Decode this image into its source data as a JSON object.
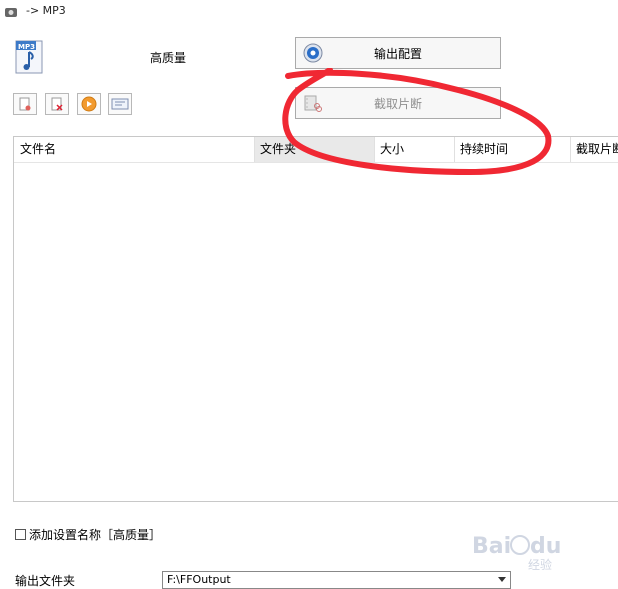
{
  "window": {
    "title": "-> MP3"
  },
  "header": {
    "quality_label": "高质量",
    "output_config_label": "输出配置",
    "clip_label": "截取片断"
  },
  "toolbar": {
    "buttons": [
      "remove-file",
      "clear-list",
      "play",
      "view-info"
    ]
  },
  "filelist": {
    "columns": [
      "文件名",
      "文件夹",
      "大小",
      "持续时间",
      "截取片断"
    ]
  },
  "options": {
    "add_setting_name_label": "添加设置名称［高质量］",
    "add_setting_name_checked": false
  },
  "output": {
    "folder_label": "输出文件夹",
    "folder_value": "F:\\FFOutput"
  },
  "watermark": {
    "text": "Bai du 经验"
  },
  "colors": {
    "annotation": "#f02833",
    "accent": "#2a6ec8"
  }
}
